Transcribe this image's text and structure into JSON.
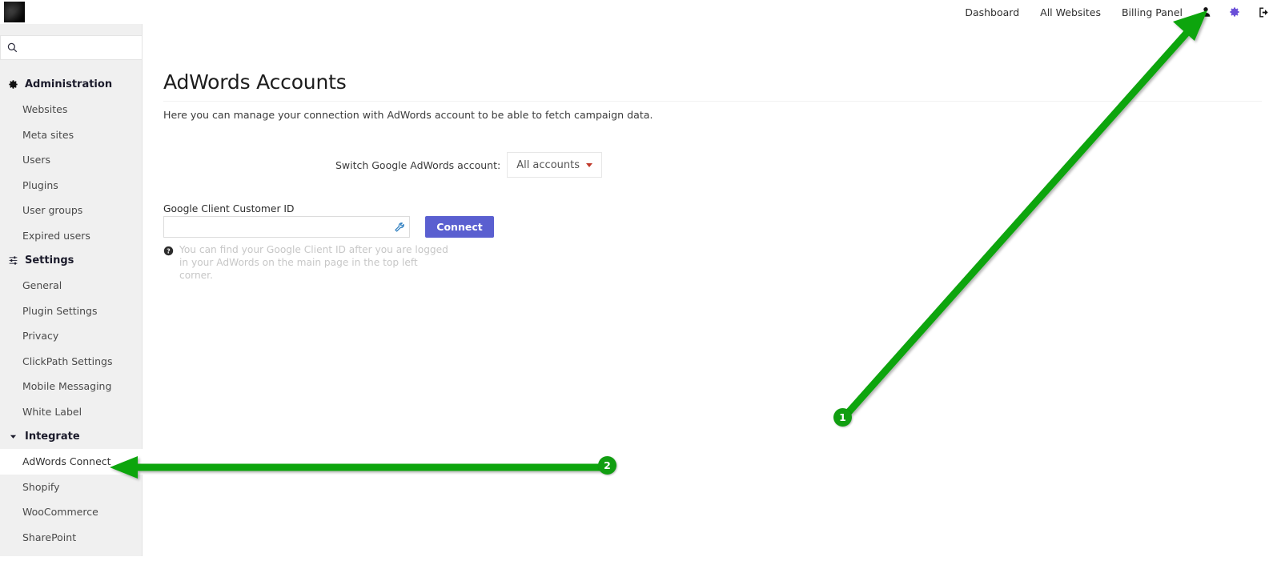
{
  "brand": {
    "logo_name": "app-logo"
  },
  "search": {
    "value": "",
    "placeholder": "",
    "icon": "search-icon"
  },
  "topnav": {
    "links": [
      {
        "label": "Dashboard",
        "name": "dashboard"
      },
      {
        "label": "All Websites",
        "name": "all-websites"
      },
      {
        "label": "Billing Panel",
        "name": "billing-panel"
      }
    ],
    "icons": [
      {
        "name": "user-icon",
        "color": "#1a1a1a"
      },
      {
        "name": "gear-icon",
        "color": "#6a4fd8"
      },
      {
        "name": "logout-icon",
        "color": "#1a1a1a"
      }
    ]
  },
  "sidebar": {
    "sections": [
      {
        "title": "Administration",
        "icon": "gear-icon",
        "items": [
          {
            "label": "Websites",
            "active": false
          },
          {
            "label": "Meta sites",
            "active": false
          },
          {
            "label": "Users",
            "active": false
          },
          {
            "label": "Plugins",
            "active": false
          },
          {
            "label": "User groups",
            "active": false
          },
          {
            "label": "Expired users",
            "active": false
          }
        ]
      },
      {
        "title": "Settings",
        "icon": "sliders-icon",
        "items": [
          {
            "label": "General",
            "active": false
          },
          {
            "label": "Plugin Settings",
            "active": false
          },
          {
            "label": "Privacy",
            "active": false
          },
          {
            "label": "ClickPath Settings",
            "active": false
          },
          {
            "label": "Mobile Messaging",
            "active": false
          },
          {
            "label": "White Label",
            "active": false
          }
        ]
      },
      {
        "title": "Integrate",
        "icon": "chevron-down-icon",
        "items": [
          {
            "label": "AdWords Connect",
            "active": true
          },
          {
            "label": "Shopify",
            "active": false
          },
          {
            "label": "WooCommerce",
            "active": false
          },
          {
            "label": "SharePoint",
            "active": false
          }
        ]
      }
    ]
  },
  "main": {
    "title": "AdWords Accounts",
    "intro": "Here you can manage your connection with AdWords account to be able to fetch campaign data.",
    "switch": {
      "label": "Switch Google AdWords account:",
      "selected": "All accounts",
      "options": [
        "All accounts"
      ],
      "caret_color": "#c0392b"
    },
    "form": {
      "field_label": "Google Client Customer ID",
      "field_value": "",
      "field_placeholder": "",
      "field_icon": "wrench-icon",
      "submit_label": "Connect",
      "submit_color": "#5a5fd0",
      "hint_icon": "question-circle-icon",
      "hint_text": "You can find your Google Client ID after you are logged in your AdWords on the main page in the top left corner."
    }
  },
  "annotations": {
    "color": "#11a511",
    "steps": [
      {
        "number": "1",
        "target": "gear-icon"
      },
      {
        "number": "2",
        "target": "sidebar-item-adwords-connect"
      }
    ]
  }
}
